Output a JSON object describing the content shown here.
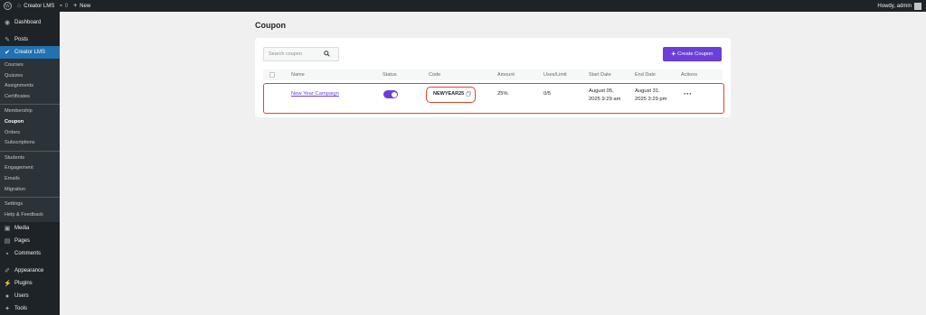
{
  "adminbar": {
    "site_name": "Creator LMS",
    "comments_count": "0",
    "new_label": "New",
    "greeting": "Howdy, admin"
  },
  "sidebar": {
    "dashboard": "Dashboard",
    "posts": "Posts",
    "creator_lms": "Creator LMS",
    "sub_group1": [
      "Courses",
      "Quizzes",
      "Assignments",
      "Certificates"
    ],
    "sub_group2": [
      "Membership",
      "Coupon",
      "Orders",
      "Subscriptions"
    ],
    "sub_group3": [
      "Students",
      "Engagement",
      "Emails",
      "Migration"
    ],
    "sub_group4": [
      "Settings",
      "Help & Feedback"
    ],
    "media": "Media",
    "pages": "Pages",
    "comments": "Comments",
    "appearance": "Appearance",
    "plugins": "Plugins",
    "users": "Users",
    "tools": "Tools"
  },
  "page": {
    "title": "Coupon",
    "search_placeholder": "Search coupon",
    "create_button": "Create Coupon"
  },
  "table": {
    "columns": {
      "name": "Name",
      "status": "Status",
      "code": "Code",
      "amount": "Amount",
      "uses": "Uses/Limit",
      "start": "Start Date",
      "end": "End Date",
      "actions": "Actions"
    },
    "rows": [
      {
        "name": "New Year Campaign",
        "status_on": true,
        "code": "NEWYEAR25",
        "amount": "25%",
        "uses": "0/5",
        "start_line1": "August 05,",
        "start_line2": "2025 9:29 am",
        "end_line1": "August 31,",
        "end_line2": "2025 3:29 pm",
        "actions": "···"
      }
    ]
  },
  "colors": {
    "accent": "#6b3fd8",
    "highlight": "#e0452b",
    "sidebar_bg": "#1d2327",
    "active_menu": "#2271b1"
  }
}
